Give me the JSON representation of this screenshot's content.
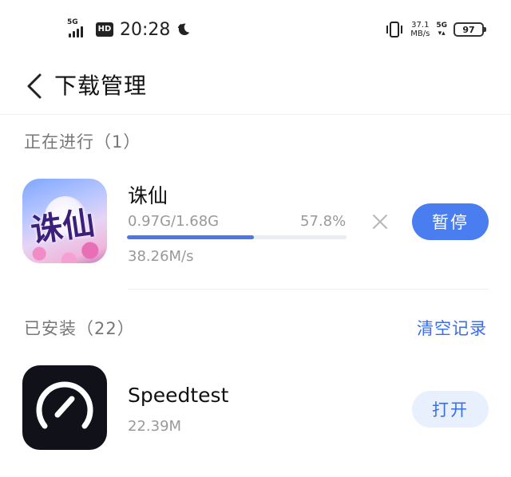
{
  "status_bar": {
    "network_label": "5G",
    "hd_label": "HD",
    "time": "20:28",
    "speed_value": "37.1",
    "speed_unit": "MB/s",
    "network_right": "5G",
    "battery": "97",
    "icons": [
      "signal-icon",
      "hd-icon",
      "moon-icon",
      "vibrate-icon",
      "battery-icon"
    ]
  },
  "header": {
    "title": "下载管理",
    "back_icon": "chevron-left-icon"
  },
  "downloading": {
    "section_title": "正在进行（1）",
    "items": [
      {
        "name": "诛仙",
        "logo_text": "诛仙",
        "progress_text": "0.97G/1.68G",
        "percent_text": "57.8%",
        "progress": 0.578,
        "speed": "38.26M/s",
        "pause_label": "暂停",
        "cancel_icon": "close-icon"
      }
    ]
  },
  "installed": {
    "section_title": "已安装（22）",
    "clear_label": "清空记录",
    "items": [
      {
        "name": "Speedtest",
        "size": "22.39M",
        "open_label": "打开",
        "icon": "speedometer-icon"
      }
    ]
  },
  "colors": {
    "accent": "#4a7ef0",
    "link": "#3a6ee8",
    "secondary_text": "#999999",
    "section_text": "#777777",
    "open_button_bg": "#e8effd"
  }
}
